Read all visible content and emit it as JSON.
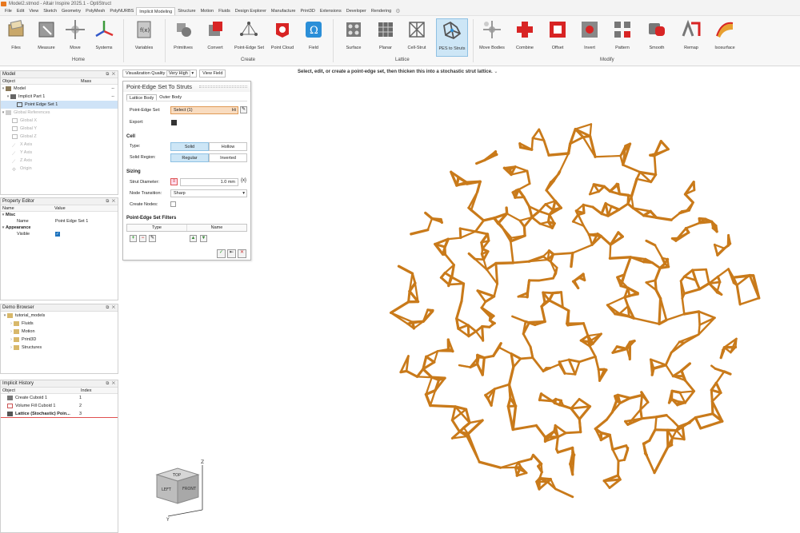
{
  "window": {
    "title": "Model2.stmod - Altair Inspire 2025.1 - OptiStruct"
  },
  "menu": [
    "File",
    "Edit",
    "View",
    "Sketch",
    "Geometry",
    "PolyMesh",
    "PolyNURBS",
    "Implicit Modeling",
    "Structure",
    "Motion",
    "Fluids",
    "Design Explorer",
    "Manufacture",
    "Print3D",
    "Extensions",
    "Developer",
    "Rendering"
  ],
  "menu_active": "Implicit Modeling",
  "ribbon": {
    "home": {
      "label": "Home",
      "tools": [
        "Files",
        "Measure",
        "Move",
        "Systems"
      ]
    },
    "variables": "Variables",
    "create": {
      "label": "Create",
      "tools": [
        "Primitives",
        "Convert",
        "Point-Edge Set",
        "Point Cloud",
        "Field"
      ]
    },
    "lattice": {
      "label": "Lattice",
      "tools": [
        "Surface",
        "Planar",
        "Cell-Strut",
        "PES to Struts"
      ]
    },
    "modify": {
      "label": "Modify",
      "tools": [
        "Move Bodies",
        "Combine",
        "Offset",
        "Invert",
        "Pattern",
        "Smooth",
        "Remap",
        "Isosurface"
      ]
    }
  },
  "model_panel": {
    "title": "Model",
    "cols": [
      "Object",
      "Mass"
    ],
    "rows": [
      {
        "label": "Model",
        "dash": "--"
      },
      {
        "label": "Implicit Part 1",
        "dash": "--"
      },
      {
        "label": "Point Edge Set 1"
      },
      {
        "label": "Global References"
      },
      {
        "label": "Global X"
      },
      {
        "label": "Global Y"
      },
      {
        "label": "Global Z"
      },
      {
        "label": "X Axis"
      },
      {
        "label": "Y Axis"
      },
      {
        "label": "Z Axis"
      },
      {
        "label": "Origin"
      }
    ]
  },
  "property_panel": {
    "title": "Property Editor",
    "cols": [
      "Name",
      "Value"
    ],
    "misc": "Misc",
    "name_label": "Name",
    "name_value": "Point Edge Set 1",
    "appearance": "Appearance",
    "visible": "Visible"
  },
  "demo_panel": {
    "title": "Demo Browser",
    "items": [
      "tutorial_models",
      "Fluids",
      "Motion",
      "Print3D",
      "Structures"
    ]
  },
  "history_panel": {
    "title": "Implicit History",
    "cols": [
      "Object",
      "Index"
    ],
    "rows": [
      {
        "label": "Create Cuboid 1",
        "index": "1"
      },
      {
        "label": "Volume Fill Cuboid 1",
        "index": "2"
      },
      {
        "label": "Lattice (Stochastic) Poin...",
        "index": "3"
      }
    ]
  },
  "viz": {
    "label": "Visualization Quality",
    "value": "Very High",
    "button": "View Field"
  },
  "instruction": "Select, edit, or create a point-edge set, then thicken this into a stochastic strut lattice.",
  "dialog": {
    "title": "Point-Edge Set To Struts",
    "tabs": [
      "Lattice Body",
      "Outer Body"
    ],
    "pes_label": "Point-Edge Set:",
    "pes_value": "Select (1)",
    "pes_suffix": "Hi",
    "export_label": "Export:",
    "cell": "Cell",
    "type_label": "Type:",
    "type_options": [
      "Solid",
      "Hollow"
    ],
    "solid_region_label": "Solid Region:",
    "solid_region_options": [
      "Regular",
      "Inverted"
    ],
    "sizing": "Sizing",
    "strut_label": "Strut Diameter:",
    "strut_value": "1.0 mm",
    "node_label": "Node Transition:",
    "node_value": "Sharp",
    "create_nodes_label": "Create Nodes:",
    "filters": "Point-Edge Set Filters",
    "filter_cols": [
      "Type",
      "Name"
    ]
  },
  "navcube": {
    "top": "TOP",
    "left": "LEFT",
    "front": "FRONT",
    "axis_z": "Z",
    "axis_y": "Y"
  },
  "colors": {
    "lattice": "#c97a1a",
    "accent": "#1e73be",
    "selection": "#cfe3f7"
  }
}
